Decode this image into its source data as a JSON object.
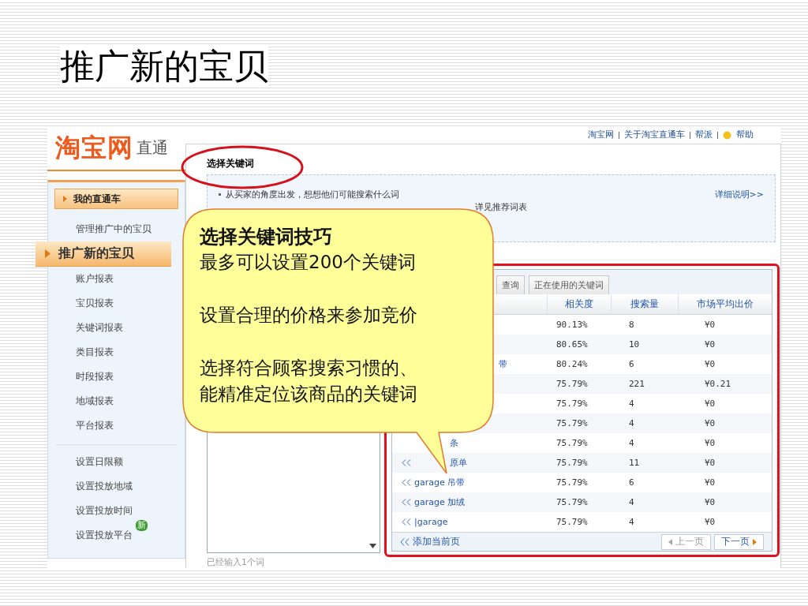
{
  "slide": {
    "title": "推广新的宝贝"
  },
  "site": {
    "logo": "淘宝网",
    "product": "直通",
    "top_links": [
      "淘宝网",
      "关于淘宝直通车",
      "帮派",
      "帮助"
    ]
  },
  "sidebar": {
    "header": "我的直通车",
    "sections": [
      [
        {
          "label": "管理推广中的宝贝",
          "selected": false
        },
        {
          "label": "推广新的宝贝",
          "selected": true
        },
        {
          "label": "账户报表",
          "selected": false
        },
        {
          "label": "宝贝报表",
          "selected": false
        },
        {
          "label": "关键词报表",
          "selected": false
        },
        {
          "label": "类目报表",
          "selected": false
        },
        {
          "label": "时段报表",
          "selected": false
        },
        {
          "label": "地域报表",
          "selected": false
        },
        {
          "label": "平台报表",
          "selected": false
        }
      ],
      [
        {
          "label": "设置日限额",
          "selected": false
        },
        {
          "label": "设置投放地域",
          "selected": false
        },
        {
          "label": "设置投放时间",
          "selected": false
        },
        {
          "label": "设置投放平台",
          "selected": false,
          "badge": "新"
        }
      ]
    ]
  },
  "panel": {
    "title": "选择关键词",
    "tips": [
      "从买家的角度出发，想想他们可能搜索什么词",
      "详见推荐词表"
    ],
    "detail_link": "详细说明>>",
    "input_status": "已经输入1个词"
  },
  "keyword_table": {
    "tabs": [
      {
        "label": "查询",
        "selected": false
      },
      {
        "label": "正在使用的关键词",
        "selected": false
      }
    ],
    "columns": [
      "相关度",
      "搜索量",
      "市场平均出价"
    ],
    "rows": [
      {
        "add": false,
        "relevance": "90.13%",
        "searches": "8",
        "price": "¥0"
      },
      {
        "add": false,
        "relevance": "80.65%",
        "searches": "10",
        "price": "¥0"
      },
      {
        "add": false,
        "keyword": "带",
        "kind": "edge",
        "relevance": "80.24%",
        "searches": "6",
        "price": "¥0"
      },
      {
        "add": false,
        "relevance": "75.79%",
        "searches": "221",
        "price": "¥0.21"
      },
      {
        "add": false,
        "relevance": "75.79%",
        "searches": "4",
        "price": "¥0"
      },
      {
        "add": false,
        "relevance": "75.79%",
        "searches": "4",
        "price": "¥0"
      },
      {
        "add": false,
        "keyword": "条",
        "kind": "tail",
        "relevance": "75.79%",
        "searches": "4",
        "price": "¥0"
      },
      {
        "add": true,
        "keyword": "原单",
        "kind": "tail",
        "relevance": "75.79%",
        "searches": "11",
        "price": "¥0"
      },
      {
        "add": true,
        "keyword": "garage 吊带",
        "kind": "full",
        "relevance": "75.79%",
        "searches": "6",
        "price": "¥0"
      },
      {
        "add": true,
        "keyword": "garage 加绒",
        "kind": "full",
        "relevance": "75.79%",
        "searches": "4",
        "price": "¥0"
      },
      {
        "add": true,
        "keyword": "|garage",
        "kind": "full",
        "relevance": "75.79%",
        "searches": "4",
        "price": "¥0"
      }
    ],
    "add_page": "添加当前页",
    "pager": [
      {
        "label": "上一页",
        "disabled": true,
        "kind": "prev"
      },
      {
        "label": "下一页",
        "disabled": false,
        "kind": "next"
      }
    ]
  },
  "callout": {
    "title": "选择关键词技巧",
    "paragraphs": [
      [
        "最多可以设置200个关键词"
      ],
      [
        "设置合理的价格来参加竞价"
      ],
      [
        "选择符合顾客搜索习惯的、",
        "能精准定位该商品的关键词"
      ]
    ]
  }
}
